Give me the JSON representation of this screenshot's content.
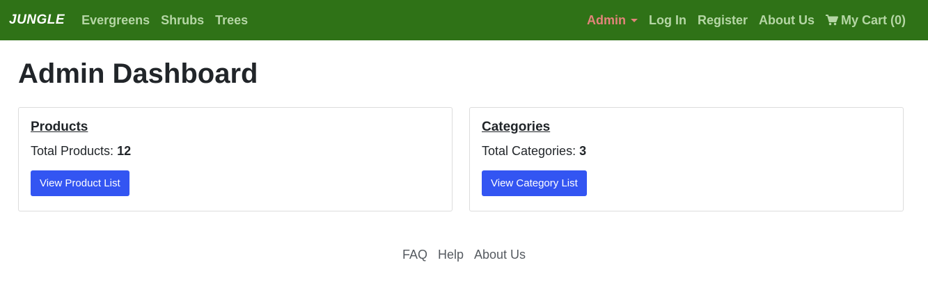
{
  "navbar": {
    "brand": "JUNGLE",
    "links": [
      "Evergreens",
      "Shrubs",
      "Trees"
    ],
    "admin_label": "Admin",
    "login_label": "Log In",
    "register_label": "Register",
    "about_label": "About Us",
    "cart_label": "My Cart (0)",
    "cart_icon": "shopping-cart-icon",
    "colors": {
      "background": "#2f7217",
      "link": "#b5d6a5",
      "admin": "#e2847a"
    }
  },
  "page": {
    "title": "Admin Dashboard"
  },
  "products_card": {
    "title": "Products",
    "label": "Total Products:",
    "count": "12",
    "button": "View Product List"
  },
  "categories_card": {
    "title": "Categories",
    "label": "Total Categories:",
    "count": "3",
    "button": "View Category List"
  },
  "footer": {
    "links": [
      "FAQ",
      "Help",
      "About Us"
    ]
  },
  "colors": {
    "button": "#3355f2"
  }
}
